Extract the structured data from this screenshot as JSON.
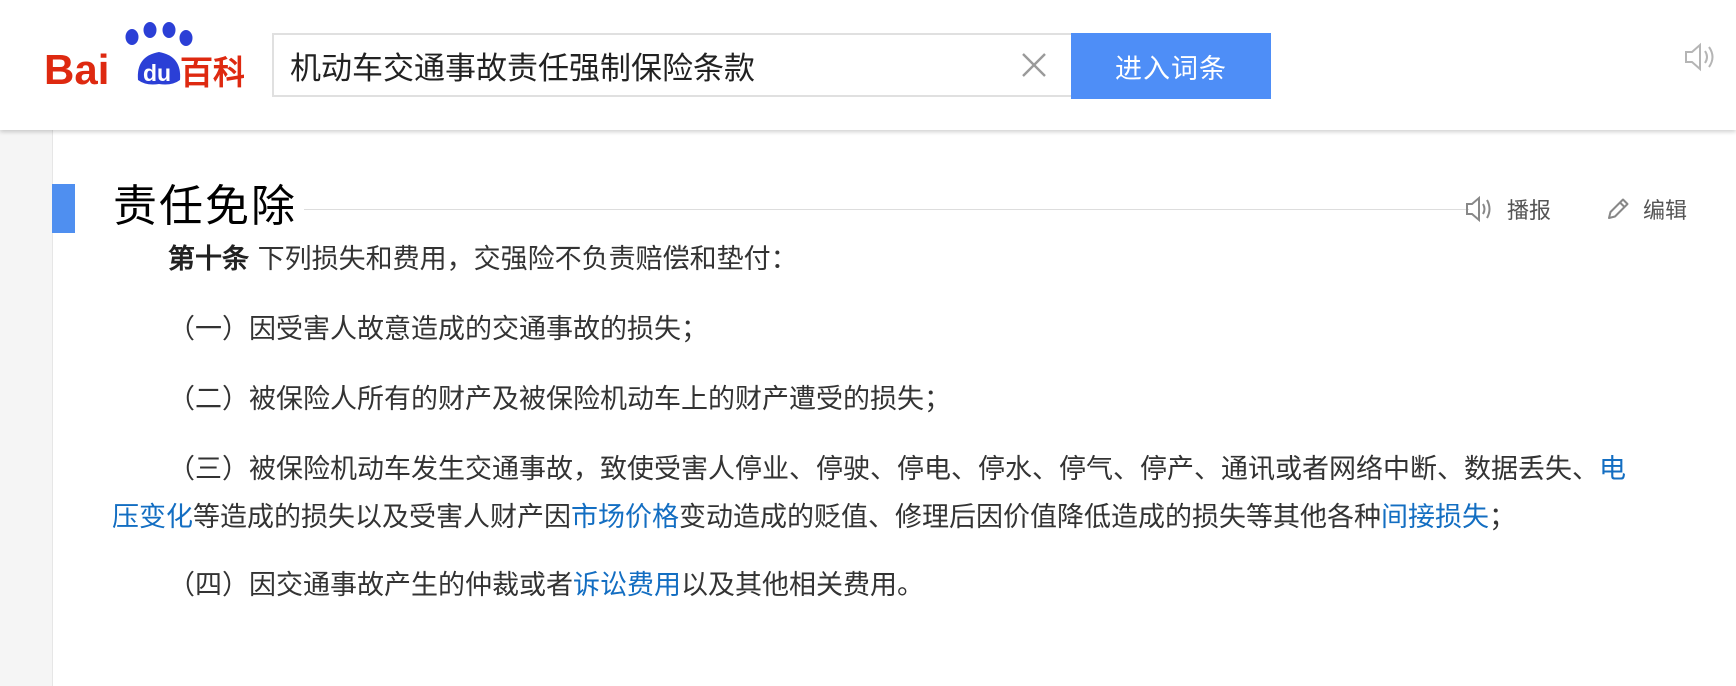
{
  "header": {
    "logo": {
      "text_left": "Bai",
      "text_du": "du",
      "text_right": "百科"
    },
    "search": {
      "value": "机动车交通事故责任强制保险条款"
    },
    "enter_button_label": "进入词条"
  },
  "section": {
    "title": "责任免除",
    "actions": {
      "listen_label": "播报",
      "edit_label": "编辑"
    },
    "intro": {
      "article": "第十条",
      "text": " 下列损失和费用，交强险不负责赔偿和垫付："
    },
    "items": {
      "i1": "（一）因受害人故意造成的交通事故的损失；",
      "i2": "（二）被保险人所有的财产及被保险机动车上的财产遭受的损失；",
      "i3": {
        "text_a": "（三）被保险机动车发生交通事故，致使受害人停业、停驶、停电、停水、停气、停产、通讯或者网络中断、数据丢失、",
        "link_a": "电",
        "link_b": "压变化",
        "text_b": "等造成的损失以及受害人财产因",
        "link_c": "市场价格",
        "text_c": "变动造成的贬值、修理后因价值降低造成的损失等其他各种",
        "link_d": "间接损失",
        "text_d": "；"
      },
      "i4": {
        "text_a": "（四）因交通事故产生的仲裁或者",
        "link_a": "诉讼费用",
        "text_b": "以及其他相关费用。"
      }
    }
  },
  "icons": {
    "speaker": "speaker-icon",
    "pencil": "pencil-icon",
    "close": "close-icon",
    "paw": "paw-icon"
  },
  "colors": {
    "brand_red": "#de2910",
    "brand_blue": "#2b3fd6",
    "button_blue": "#4e8ef7",
    "link_blue": "#136ec2",
    "section_bar": "#4f8ff0"
  }
}
